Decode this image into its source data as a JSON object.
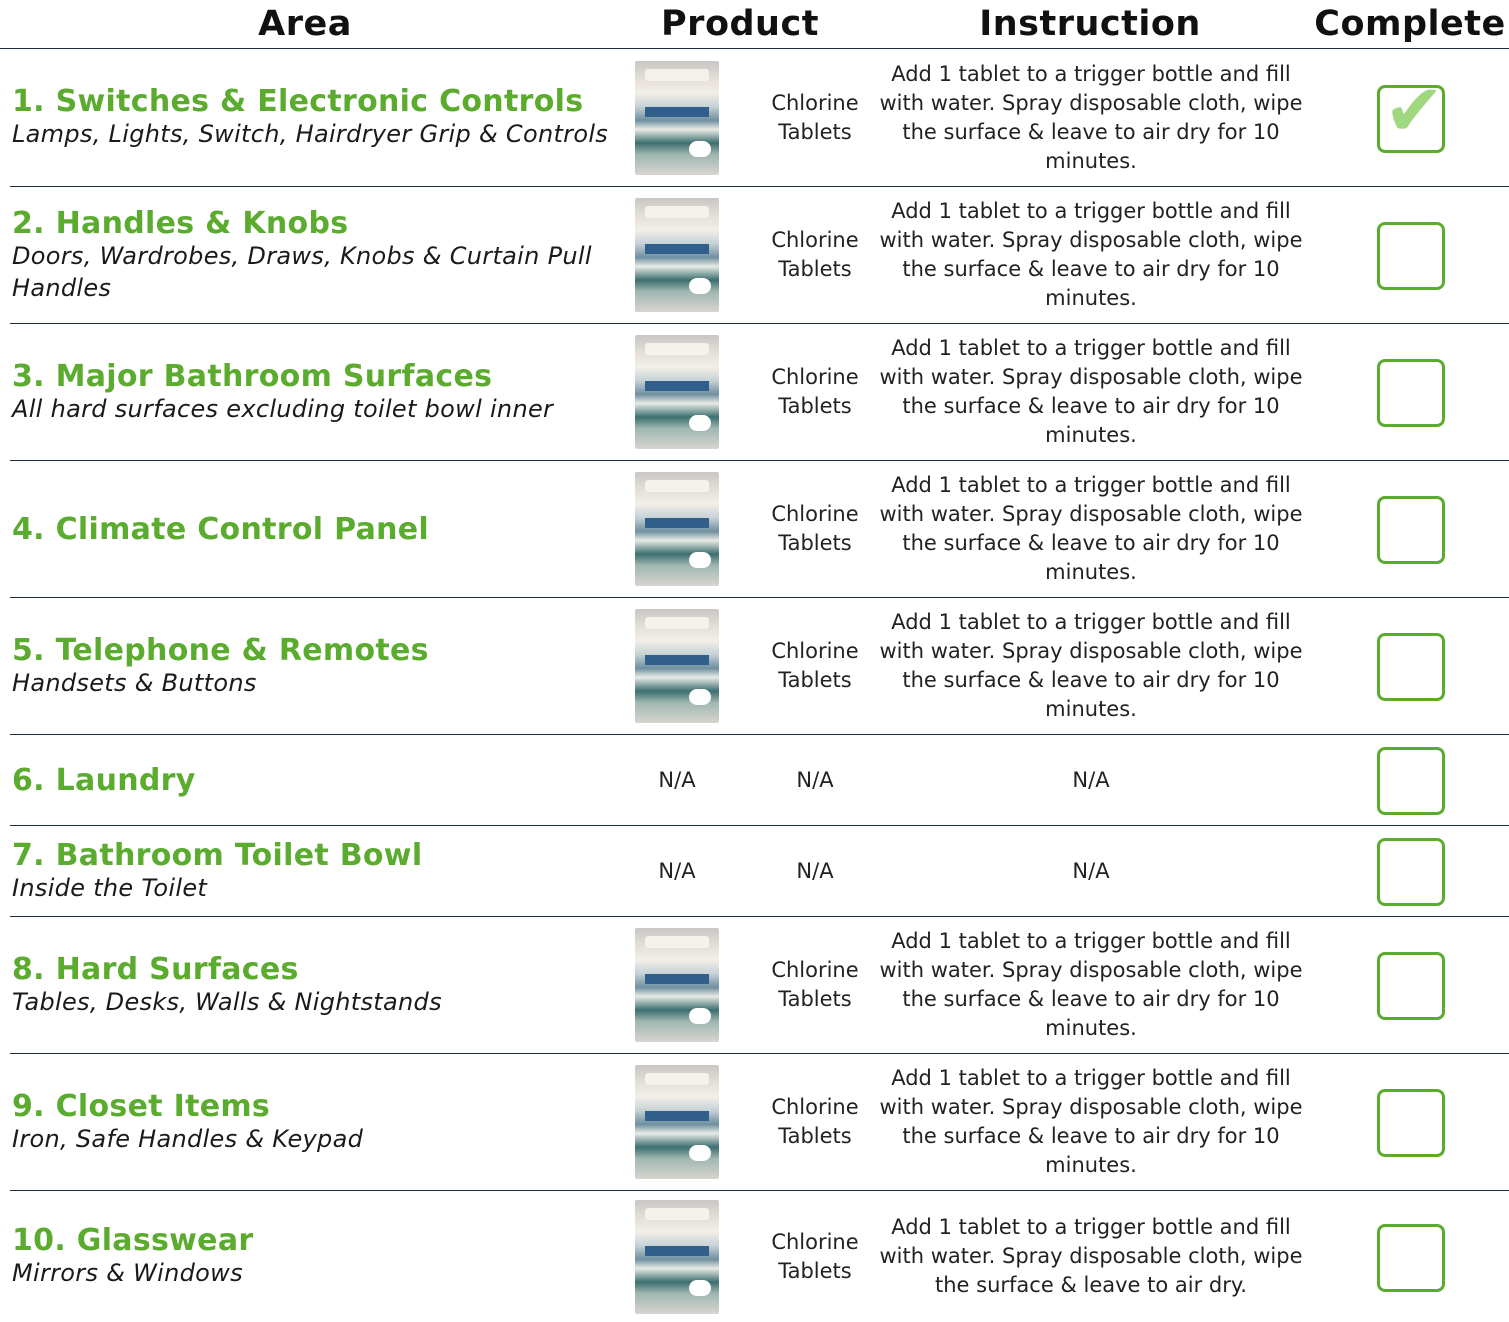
{
  "header": {
    "area": "Area",
    "product": "Product",
    "instruction": "Instruction",
    "complete": "Complete"
  },
  "rows": [
    {
      "title": "1. Switches & Electronic Controls",
      "subtitle": "Lamps, Lights, Switch, Hairdryer Grip & Controls",
      "product": "Chlorine Tablets",
      "instruction": "Add 1 tablet to a trigger bottle and fill with water. Spray disposable cloth, wipe the surface & leave to air dry for 10 minutes.",
      "complete": true
    },
    {
      "title": "2. Handles & Knobs",
      "subtitle": "Doors, Wardrobes, Draws, Knobs & Curtain Pull Handles",
      "product": "Chlorine Tablets",
      "instruction": "Add 1 tablet to a trigger bottle and fill with water. Spray disposable cloth, wipe the surface & leave to air dry for 10 minutes.",
      "complete": false
    },
    {
      "title": "3. Major Bathroom Surfaces",
      "subtitle": "All hard surfaces excluding toilet bowl inner",
      "product": "Chlorine Tablets",
      "instruction": "Add 1 tablet to a trigger bottle and fill with water. Spray disposable cloth, wipe the surface & leave to air dry for 10 minutes.",
      "complete": false
    },
    {
      "title": "4. Climate Control Panel",
      "subtitle": "",
      "product": "Chlorine Tablets",
      "instruction": "Add 1 tablet to a trigger bottle and fill with water. Spray disposable cloth, wipe the surface & leave to air dry for 10 minutes.",
      "complete": false
    },
    {
      "title": "5. Telephone & Remotes",
      "subtitle": "Handsets & Buttons",
      "product": "Chlorine Tablets",
      "instruction": "Add 1 tablet to a trigger bottle and fill with water. Spray disposable cloth, wipe the surface & leave to air dry for 10 minutes.",
      "complete": false
    },
    {
      "title": "6. Laundry",
      "subtitle": "",
      "product_image": "N/A",
      "product": "N/A",
      "instruction": "N/A",
      "complete": false
    },
    {
      "title": "7. Bathroom Toilet Bowl",
      "subtitle": "Inside the Toilet",
      "product_image": "N/A",
      "product": "N/A",
      "instruction": "N/A",
      "complete": false
    },
    {
      "title": "8. Hard Surfaces",
      "subtitle": "Tables, Desks, Walls & Nightstands",
      "product": "Chlorine Tablets",
      "instruction": "Add 1 tablet to a trigger bottle and fill with water. Spray disposable cloth, wipe the surface & leave to air dry for 10 minutes.",
      "complete": false
    },
    {
      "title": "9. Closet Items",
      "subtitle": "Iron, Safe Handles & Keypad",
      "product": "Chlorine Tablets",
      "instruction": "Add 1 tablet to a trigger bottle and fill with water. Spray disposable cloth, wipe the surface & leave to air dry for 10 minutes.",
      "complete": false
    },
    {
      "title": "10. Glasswear",
      "subtitle": "Mirrors & Windows",
      "product": "Chlorine Tablets",
      "instruction": "Add 1 tablet to a trigger bottle and fill with water. Spray disposable cloth, wipe the surface & leave to air dry.",
      "complete": false
    }
  ],
  "check_glyph": "✔",
  "colors": {
    "accent": "#5aab2e",
    "check": "#9fd87f",
    "rule": "#1f2a44"
  }
}
